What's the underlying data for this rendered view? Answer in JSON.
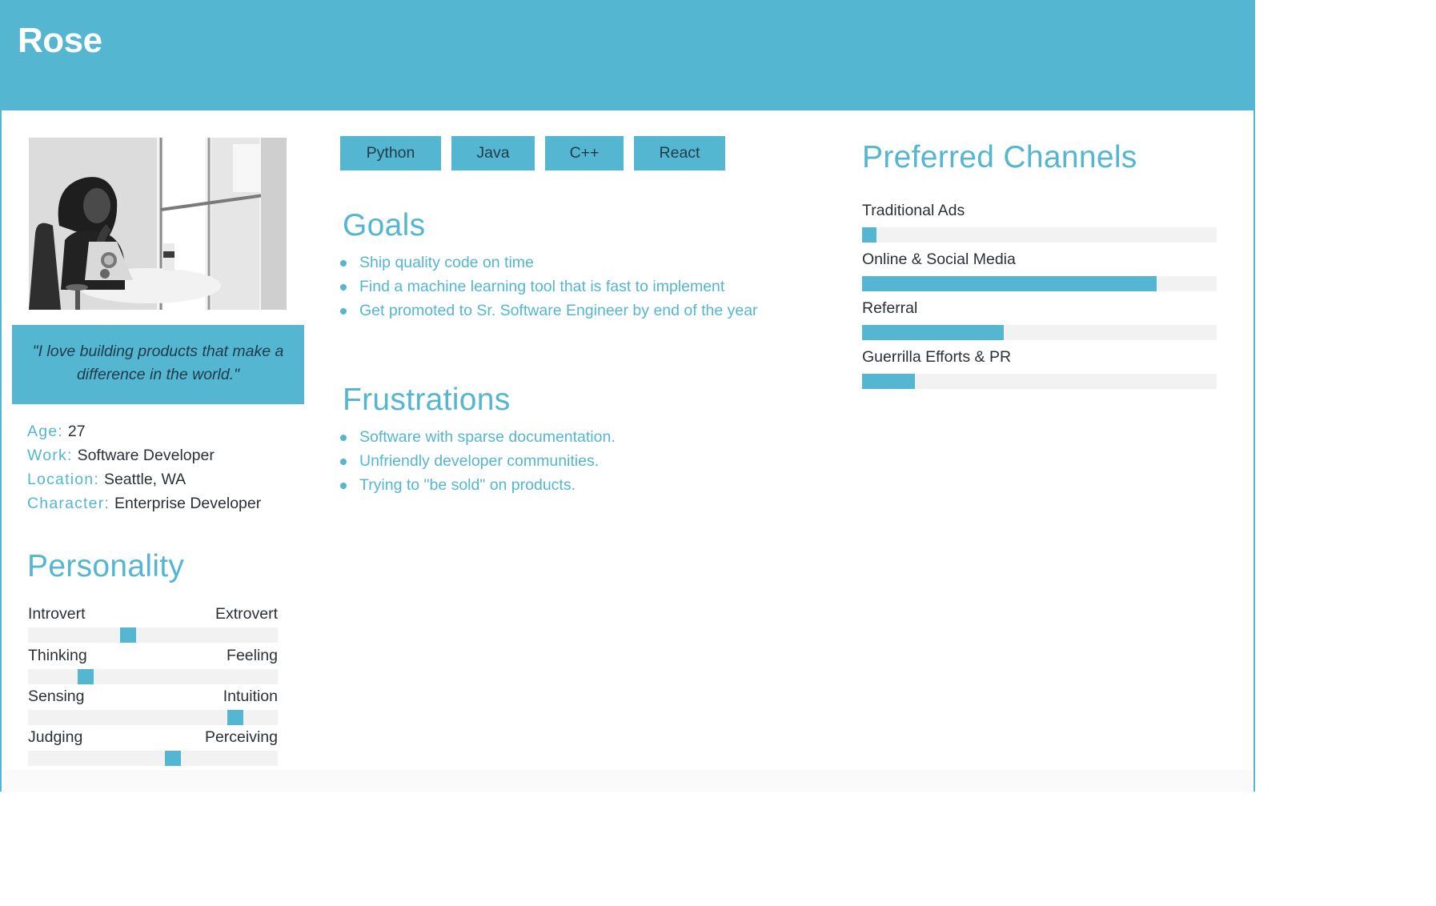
{
  "persona": {
    "name": "Rose",
    "quote": "\"I love building products that make a difference in the world.\"",
    "facts": [
      {
        "key": "Age:",
        "value": "27"
      },
      {
        "key": "Work:",
        "value": "Software Developer"
      },
      {
        "key": "Location:",
        "value": "Seattle, WA"
      },
      {
        "key": "Character:",
        "value": "Enterprise Developer"
      }
    ]
  },
  "personality": {
    "title": "Personality",
    "traits": [
      {
        "left": "Introvert",
        "right": "Extrovert",
        "level": 0.4
      },
      {
        "left": "Thinking",
        "right": "Feeling",
        "level": 0.23
      },
      {
        "left": "Sensing",
        "right": "Intuition",
        "level": 0.83
      },
      {
        "left": "Judging",
        "right": "Perceiving",
        "level": 0.58
      }
    ]
  },
  "tags": [
    "Python",
    "Java",
    "C++",
    "React"
  ],
  "goals": {
    "title": "Goals",
    "items": [
      "Ship quality code on time",
      "Find a machine learning tool that is fast to implement",
      "Get promoted to Sr. Software Engineer by end of the year"
    ]
  },
  "frustrations": {
    "title": "Frustrations",
    "items": [
      "Software with sparse documentation.",
      "Unfriendly developer communities.",
      "Trying to \"be sold\" on products."
    ]
  },
  "channels": {
    "title": "Preferred Channels",
    "items": [
      {
        "label": "Traditional Ads",
        "level": 0.04
      },
      {
        "label": "Online & Social Media",
        "level": 0.83
      },
      {
        "label": "Referral",
        "level": 0.4
      },
      {
        "label": "Guerrilla Efforts & PR",
        "level": 0.15
      }
    ]
  },
  "colors": {
    "accent": "#54b6d1",
    "text": "#2b3036",
    "track": "#f2f2f2"
  }
}
